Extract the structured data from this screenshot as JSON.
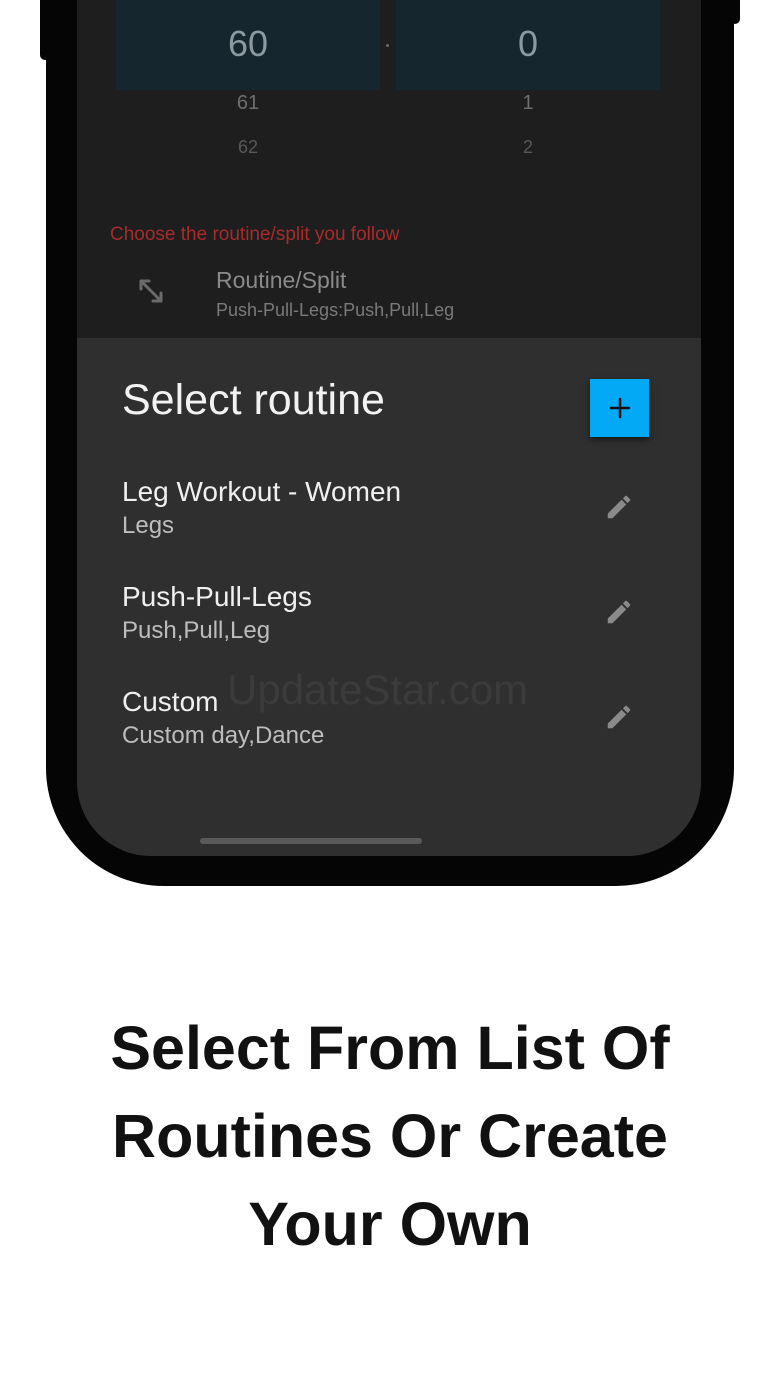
{
  "picker": {
    "left": {
      "selected": "60",
      "next": "61",
      "next2": "62"
    },
    "right": {
      "selected": "0",
      "next": "1",
      "next2": "2"
    }
  },
  "routine_field": {
    "hint": "Choose the routine/split you follow",
    "label": "Routine/Split",
    "value": "Push-Pull-Legs:Push,Pull,Leg",
    "icon": "arrows-diagonal-icon"
  },
  "sheet": {
    "title": "Select routine",
    "add_icon": "plus-icon",
    "items": [
      {
        "title": "Leg Workout - Women",
        "subtitle": "Legs",
        "icon": "pencil-icon"
      },
      {
        "title": "Push-Pull-Legs",
        "subtitle": "Push,Pull,Leg",
        "icon": "pencil-icon"
      },
      {
        "title": "Custom",
        "subtitle": "Custom day,Dance",
        "icon": "pencil-icon"
      }
    ]
  },
  "watermark": "UpdateStar.com",
  "caption": {
    "line1": "Select From List Of",
    "line2": "Routines Or Create",
    "line3": "Your Own"
  },
  "colors": {
    "accent": "#03a9f4",
    "hint_red": "#a82b2b",
    "sheet_bg": "#2f2f2f",
    "screen_bg": "#1e1e1e"
  }
}
